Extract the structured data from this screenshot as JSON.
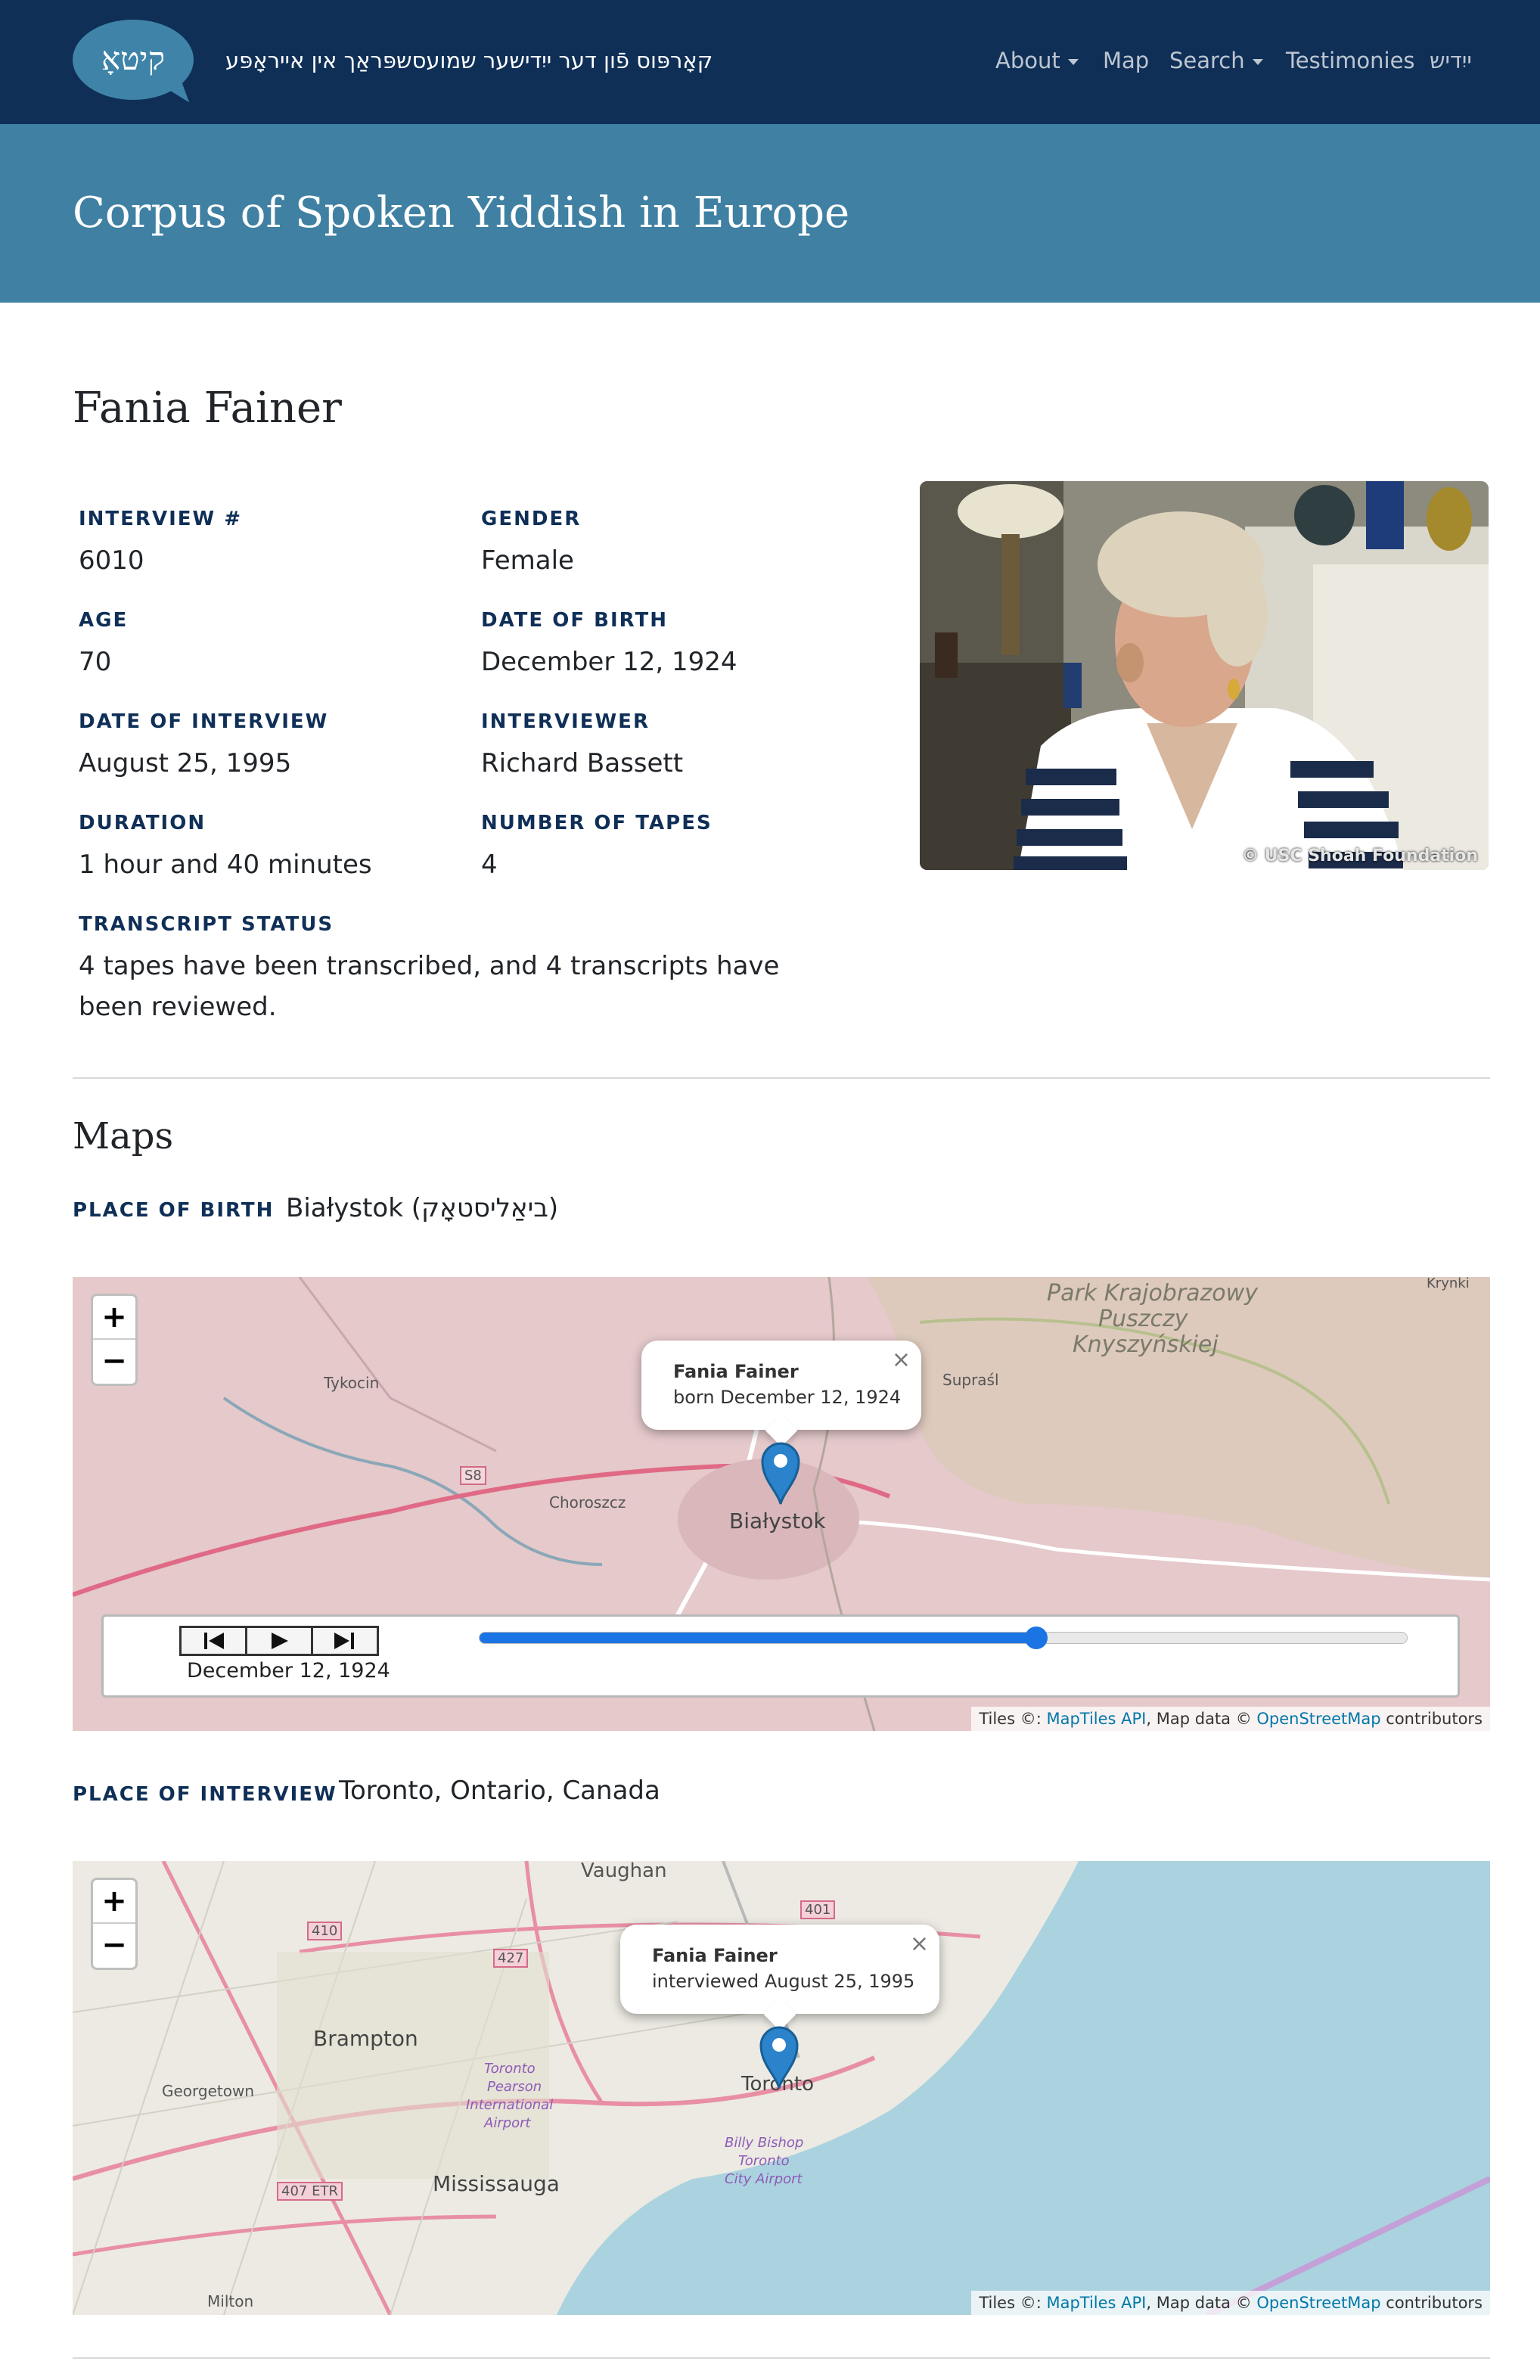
{
  "navbar": {
    "logo_text": "קיטאָ",
    "brand_text": "קאָרפּוס פֿון דער ייִדישער שמועסשפּראַך אין אייראָפּע",
    "items": [
      {
        "label": "About",
        "dropdown": true
      },
      {
        "label": "Map",
        "dropdown": false
      },
      {
        "label": "Search",
        "dropdown": true
      },
      {
        "label": "Testimonies",
        "dropdown": false
      },
      {
        "label": "ייִדיש",
        "dropdown": false
      }
    ]
  },
  "site_title": "Corpus of Spoken Yiddish in Europe",
  "person": {
    "name": "Fania Fainer",
    "fields": [
      {
        "label": "INTERVIEW #",
        "value": "6010"
      },
      {
        "label": "GENDER",
        "value": "Female"
      },
      {
        "label": "AGE",
        "value": "70"
      },
      {
        "label": "DATE OF BIRTH",
        "value": "December 12, 1924"
      },
      {
        "label": "DATE OF INTERVIEW",
        "value": "August 25, 1995"
      },
      {
        "label": "INTERVIEWER",
        "value": "Richard Bassett"
      },
      {
        "label": "DURATION",
        "value": "1 hour and 40 minutes"
      },
      {
        "label": "NUMBER OF TAPES",
        "value": "4"
      },
      {
        "label": "TRANSCRIPT STATUS",
        "value": "4 tapes have been transcribed, and 4 transcripts have been reviewed."
      }
    ],
    "photo_credit": "© USC Shoah Foundation"
  },
  "maps": {
    "heading": "Maps",
    "birth": {
      "label": "PLACE OF BIRTH",
      "value": "Białystok (ביאַליסטאָק)",
      "popup_name": "Fania Fainer",
      "popup_sub": "born December 12, 1924",
      "place_labels": [
        "Park Krajobrazowy",
        "Puszczy",
        "Knyszyńskiej",
        "Krynki",
        "Tykocin",
        "Supraśl",
        "Choroszcz",
        "Białystok",
        "S8"
      ],
      "timeline": {
        "date": "December 12, 1924",
        "progress": 0.6
      }
    },
    "interview": {
      "label": "PLACE OF INTERVIEW",
      "value": "Toronto, Ontario, Canada",
      "popup_name": "Fania Fainer",
      "popup_sub": "interviewed August 25, 1995",
      "place_labels": [
        "Vaughan",
        "Brampton",
        "Georgetown",
        "Mississauga",
        "Toronto",
        "Milton",
        "410",
        "427",
        "401",
        "407 ETR",
        "Toronto",
        "Pearson",
        "International",
        "Airport",
        "Billy Bishop",
        "Toronto",
        "City Airport"
      ]
    },
    "zoom_in": "+",
    "zoom_out": "−",
    "close": "×",
    "attribution": {
      "prefix": "Tiles ©: ",
      "tiles_link": "MapTiles API",
      "middle": ", Map data © ",
      "osm_link": "OpenStreetMap",
      "suffix": " contributors"
    }
  },
  "colors": {
    "navbar": "#0f2f57",
    "title_band": "#3f80a3",
    "label": "#0f2f57",
    "slider": "#1b74e4"
  }
}
